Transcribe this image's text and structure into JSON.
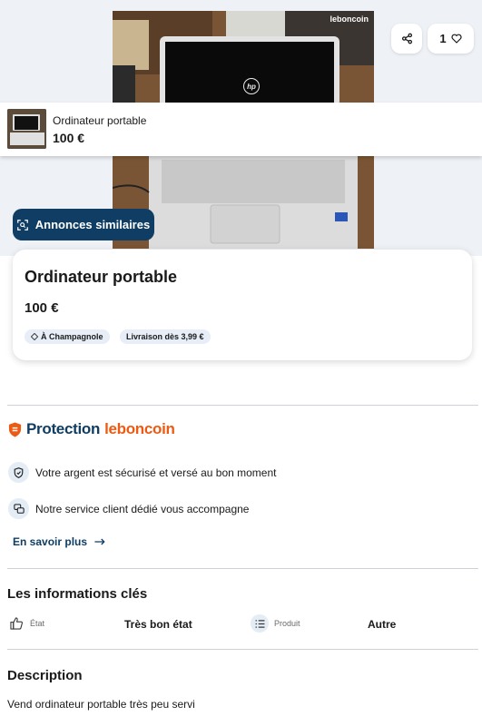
{
  "listing": {
    "title": "Ordinateur portable",
    "price": "100 €",
    "likes_count": "1"
  },
  "gallery": {
    "watermark": "leboncoin",
    "laptop_brand": "hp",
    "similar_button_label": "Annonces similaires"
  },
  "chips": {
    "location": "À Champagnole",
    "delivery": "Livraison dès 3,99 €"
  },
  "protection": {
    "title_word": "Protection",
    "title_brand": "leboncoin",
    "features": [
      "Votre argent est sécurisé et versé au bon moment",
      "Notre service client dédié vous accompagne"
    ],
    "more_link": "En savoir plus"
  },
  "key_info": {
    "section_title": "Les informations clés",
    "attributes": [
      {
        "label": "État",
        "value": "Très bon état",
        "icon": "thumbs-up-icon"
      },
      {
        "label": "Produit",
        "value": "Autre",
        "icon": "list-icon"
      }
    ]
  },
  "description": {
    "section_title": "Description",
    "text": "Vend ordinateur portable très peu servi"
  },
  "colors": {
    "brand_navy": "#0f3d63",
    "brand_orange": "#ec5a13",
    "chip_bg": "#e7eef7"
  }
}
